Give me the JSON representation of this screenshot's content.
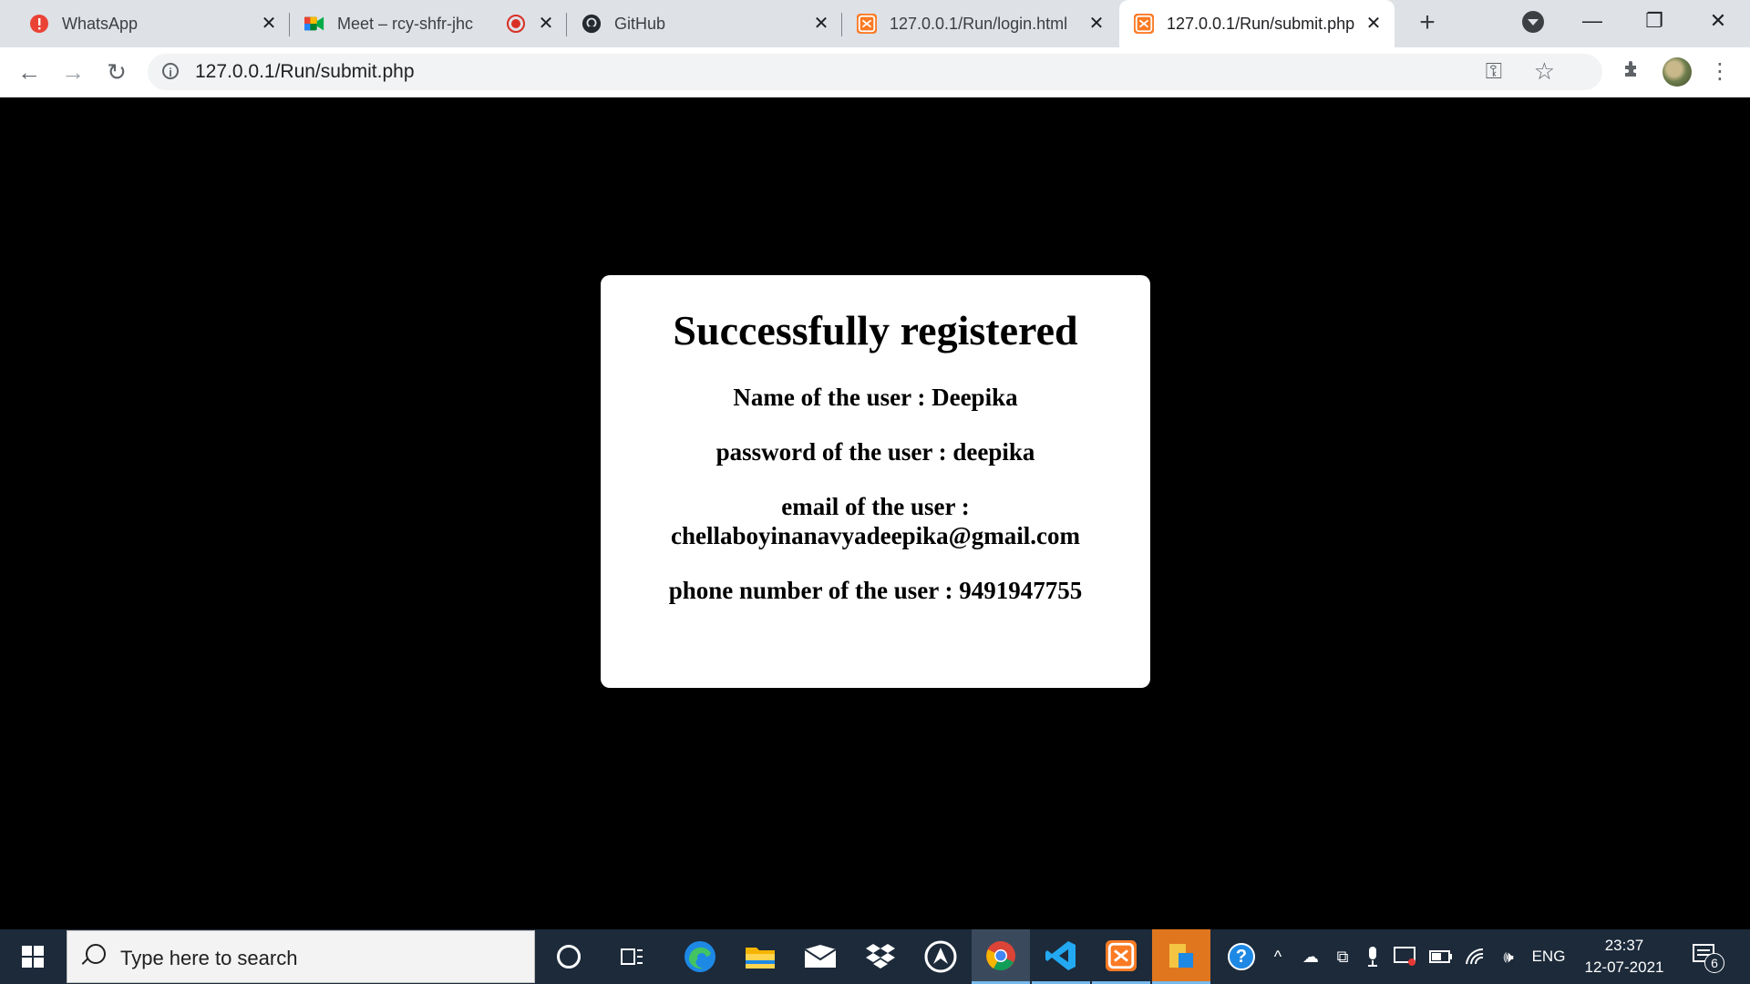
{
  "browser": {
    "tabs": [
      {
        "title": "WhatsApp",
        "icon": "whatsapp-alert-icon"
      },
      {
        "title": "Meet – rcy-shfr-jhc",
        "icon": "google-meet-icon",
        "recording": true
      },
      {
        "title": "GitHub",
        "icon": "github-icon"
      },
      {
        "title": "127.0.0.1/Run/login.html",
        "icon": "xampp-icon"
      },
      {
        "title": "127.0.0.1/Run/submit.php",
        "icon": "xampp-icon",
        "active": true
      }
    ],
    "url": "127.0.0.1/Run/submit.php"
  },
  "page": {
    "heading": "Successfully registered",
    "name_line": "Name of the user : Deepika",
    "password_line": "password of the user : deepika",
    "email_label": "email of the user :",
    "email_value": "chellaboyinanavyadeepika@gmail.com",
    "phone_line": "phone number of the user : 9491947755"
  },
  "taskbar": {
    "search_placeholder": "Type here to search",
    "language": "ENG",
    "time": "23:37",
    "date": "12-07-2021",
    "notification_count": "6"
  },
  "colors": {
    "page_background": "#000000",
    "card_background": "#ffffff",
    "tabstrip": "#dee1e6",
    "taskbar": "#1c2a3a"
  }
}
